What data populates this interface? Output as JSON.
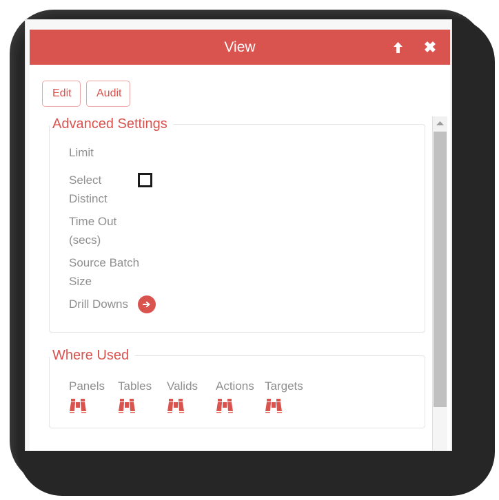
{
  "window": {
    "title": "View",
    "titlebar_color": "#d9534f",
    "accent_color": "#d9534f",
    "label_color": "#8f8f8f",
    "controls": [
      {
        "name": "collapse",
        "icon": "arrow-up-icon",
        "label": ""
      },
      {
        "name": "close",
        "icon": "close-icon",
        "label": "✖"
      }
    ]
  },
  "toolbar": {
    "edit_label": "Edit",
    "audit_label": "Audit"
  },
  "groups": {
    "advanced_settings": {
      "legend": "Advanced Settings",
      "fields": [
        {
          "label": "Limit",
          "control": "none",
          "value": ""
        },
        {
          "label": "Select Distinct",
          "control": "checkbox",
          "checked": false,
          "value": ""
        },
        {
          "label": "Time Out (secs)",
          "control": "none",
          "value": ""
        },
        {
          "label": "Source Batch Size",
          "control": "none",
          "value": ""
        },
        {
          "label": "Drill Downs",
          "control": "arrow-button",
          "value": ""
        }
      ]
    },
    "where_used": {
      "legend": "Where Used",
      "columns": [
        {
          "label": "Panels",
          "icon": "binoculars-icon"
        },
        {
          "label": "Tables",
          "icon": "binoculars-icon"
        },
        {
          "label": "Valids",
          "icon": "binoculars-icon"
        },
        {
          "label": "Actions",
          "icon": "binoculars-icon"
        },
        {
          "label": "Targets",
          "icon": "binoculars-icon"
        }
      ]
    }
  },
  "scrollbar": {
    "up_icon": "triangle-up-icon",
    "down_icon": "triangle-down-icon",
    "thumb_position": "near-top"
  }
}
